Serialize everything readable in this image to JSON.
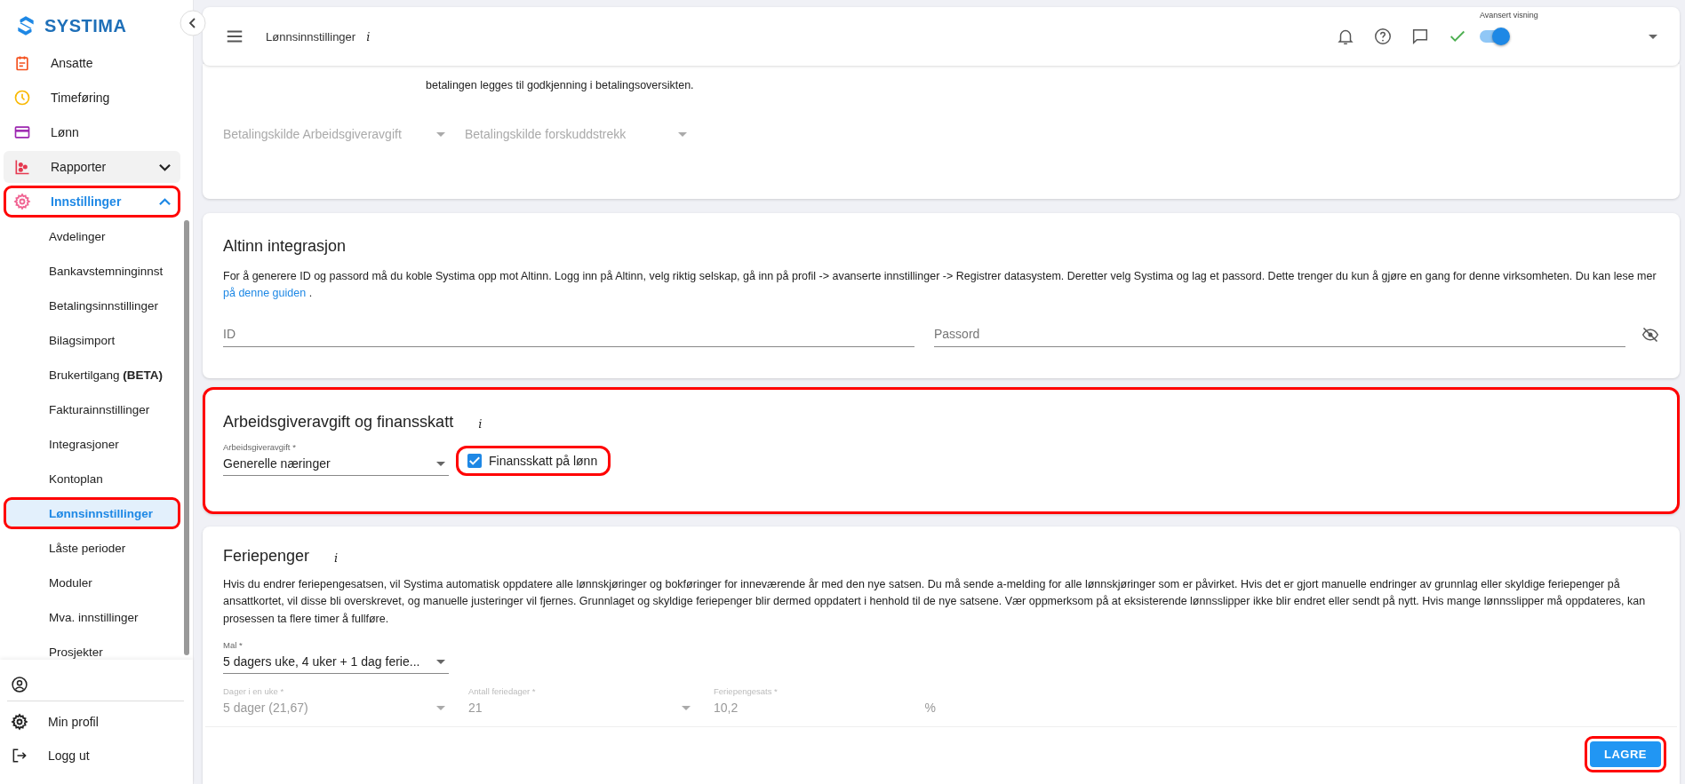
{
  "sidebar": {
    "logo": "SYSTIMA",
    "items": [
      {
        "label": "Ansatte",
        "color": "#f4511e",
        "hovered": false,
        "highlighted": false,
        "selected": false
      },
      {
        "label": "Timeføring",
        "color": "#f9b800",
        "hovered": false,
        "highlighted": false,
        "selected": false
      },
      {
        "label": "Lønn",
        "color": "#9c27b0",
        "hovered": false,
        "highlighted": false,
        "selected": false
      },
      {
        "label": "Rapporter",
        "color": "#e53950",
        "hovered": true,
        "highlighted": false,
        "selected": false,
        "expanded": false
      },
      {
        "label": "Innstillinger",
        "color": "#f06292",
        "hovered": false,
        "highlighted": true,
        "selected": true,
        "expanded": true,
        "children": [
          {
            "label": "Avdelinger",
            "selected": false,
            "highlighted": false
          },
          {
            "label": "Bankavstemninginnst",
            "selected": false,
            "highlighted": false
          },
          {
            "label": "Betalingsinnstillinger",
            "selected": false,
            "highlighted": false
          },
          {
            "label": "Bilagsimport",
            "selected": false,
            "highlighted": false
          },
          {
            "label": "Brukertilgang **(BETA)**",
            "selected": false,
            "highlighted": false
          },
          {
            "label": "Fakturainnstillinger",
            "selected": false,
            "highlighted": false
          },
          {
            "label": "Integrasjoner",
            "selected": false,
            "highlighted": false
          },
          {
            "label": "Kontoplan",
            "selected": false,
            "highlighted": false
          },
          {
            "label": "Lønnsinnstillinger",
            "selected": true,
            "highlighted": true
          },
          {
            "label": "Låste perioder",
            "selected": false,
            "highlighted": false
          },
          {
            "label": "Moduler",
            "selected": false,
            "highlighted": false
          },
          {
            "label": "Mva. innstillinger",
            "selected": false,
            "highlighted": false
          },
          {
            "label": "Prosjekter",
            "selected": false,
            "highlighted": false
          }
        ]
      }
    ],
    "bottom_items": [
      {
        "label": "Min profil"
      },
      {
        "label": "Logg ut"
      }
    ]
  },
  "header": {
    "title": "Lønnsinnstillinger",
    "info": "i",
    "advanced_view": {
      "label": "Avansert visning",
      "on": true
    }
  },
  "payment_card": {
    "text": "betalingen legges til godkjenning i betalingsoversikten.",
    "selects": [
      {
        "placeholder": "Betalingskilde Arbeidsgiveravgift",
        "disabled": true
      },
      {
        "placeholder": "Betalingskilde forskuddstrekk",
        "disabled": true
      }
    ]
  },
  "altinn_card": {
    "title": "Altinn integrasjon",
    "text_before": "For å generere ID og passord må du koble Systima opp mot Altinn. Logg inn på Altinn, velg riktig selskap, gå inn på profil -> avanserte innstillinger -> Registrer datasystem. Deretter velg Systima og lag et passord. Dette trenger du kun å gjøre en gang for denne virksomheten. Du kan lese mer",
    "link": "på denne guiden",
    "text_after": ".",
    "fields": [
      {
        "placeholder": "ID"
      },
      {
        "placeholder": "Passord"
      }
    ]
  },
  "tax_card": {
    "title": "Arbeidsgiveravgift og finansskatt",
    "info": "i",
    "highlighted": true,
    "select": {
      "label": "Arbeidsgiveravgift *",
      "value": "Generelle næringer"
    },
    "checkbox": {
      "label": "Finansskatt på lønn",
      "checked": true,
      "highlighted": true
    }
  },
  "holiday_card": {
    "title": "Feriepenger",
    "info": "i",
    "text": "Hvis du endrer feriepengesatsen, vil Systima automatisk oppdatere alle lønnskjøringer og bokføringer for inneværende år med den nye satsen. Du må sende a-melding for alle lønnskjøringer som er påvirket. Hvis det er gjort manuelle endringer av grunnlag eller skyldige feriepenger på ansattkortet, vil disse bli overskrevet, og manuelle justeringer vil fjernes. Grunnlaget og skyldige feriepenger blir dermed oppdatert i henhold til de nye satsene. Vær oppmerksom på at eksisterende lønnsslipper ikke blir endret eller sendt på nytt. Hvis mange lønnsslipper må oppdateres, kan prosessen ta flere timer å fullføre.",
    "template": {
      "label": "Mal *",
      "value": "5 dagers uke, 4 uker + 1 dag ferie...",
      "disabled": false
    },
    "fields": [
      {
        "kind": "select",
        "label": "Dager i en uke *",
        "value": "5 dager (21,67)",
        "disabled": true
      },
      {
        "kind": "select",
        "label": "Antall feriedager *",
        "value": "21",
        "disabled": true
      },
      {
        "kind": "number",
        "label": "Feriepengesats *",
        "value": "10,2",
        "suffix": "%",
        "disabled": true
      }
    ]
  },
  "save_button": {
    "label": "LAGRE",
    "highlighted": true
  }
}
